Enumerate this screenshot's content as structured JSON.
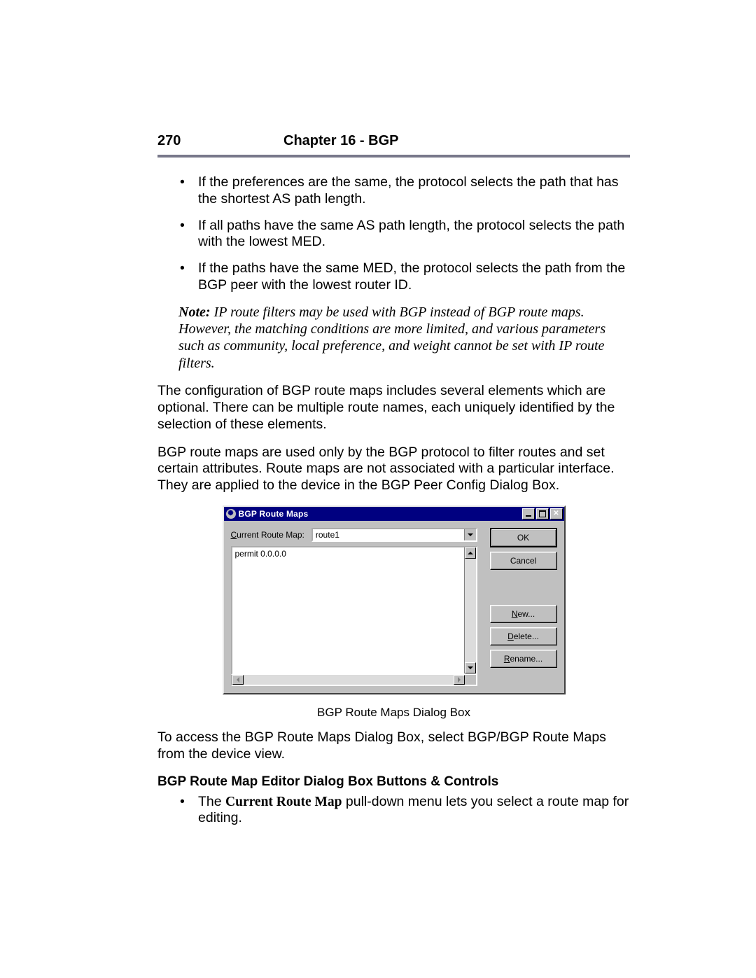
{
  "header": {
    "page_number": "270",
    "chapter": "Chapter 16 - BGP"
  },
  "bullets_top": [
    "If the preferences are the same, the protocol selects the path that has the shortest AS path length.",
    "If all paths have the same AS path length, the protocol selects the path with the lowest MED.",
    "If the paths have the same MED, the protocol selects the path from the BGP peer with the lowest router ID."
  ],
  "note": {
    "label": "Note:",
    "text": "IP route filters may be used with BGP instead of BGP route maps. However, the matching conditions are more limited, and various parameters such as community, local preference, and weight cannot be set with IP route filters."
  },
  "para1": "The configuration of BGP route maps includes several elements which are optional. There can be multiple route names, each uniquely identified by the selection of these elements.",
  "para2": "BGP route maps are used only by the BGP protocol to filter routes and set certain attributes. Route maps are not associated with a particular interface. They are applied to the device in the BGP Peer Config Dialog Box.",
  "dialog": {
    "title": "BGP Route Maps",
    "current_label_pre": "C",
    "current_label_post": "urrent Route Map:",
    "current_value": "route1",
    "list_item": "permit 0.0.0.0",
    "buttons": {
      "ok": "OK",
      "cancel": "Cancel",
      "new_u": "N",
      "new_rest": "ew...",
      "del_u": "D",
      "del_rest": "elete...",
      "ren_u": "R",
      "ren_rest": "ename..."
    },
    "close_x": "✕"
  },
  "figcaption": "BGP Route Maps Dialog Box",
  "para3": "To access the BGP Route Maps Dialog Box, select BGP/BGP Route Maps from the device view.",
  "subhead": "BGP Route Map Editor Dialog Box Buttons & Controls",
  "bullet2_pre": "The ",
  "bullet2_bold": "Current Route Map",
  "bullet2_post": " pull-down menu lets you select a route map for editing."
}
